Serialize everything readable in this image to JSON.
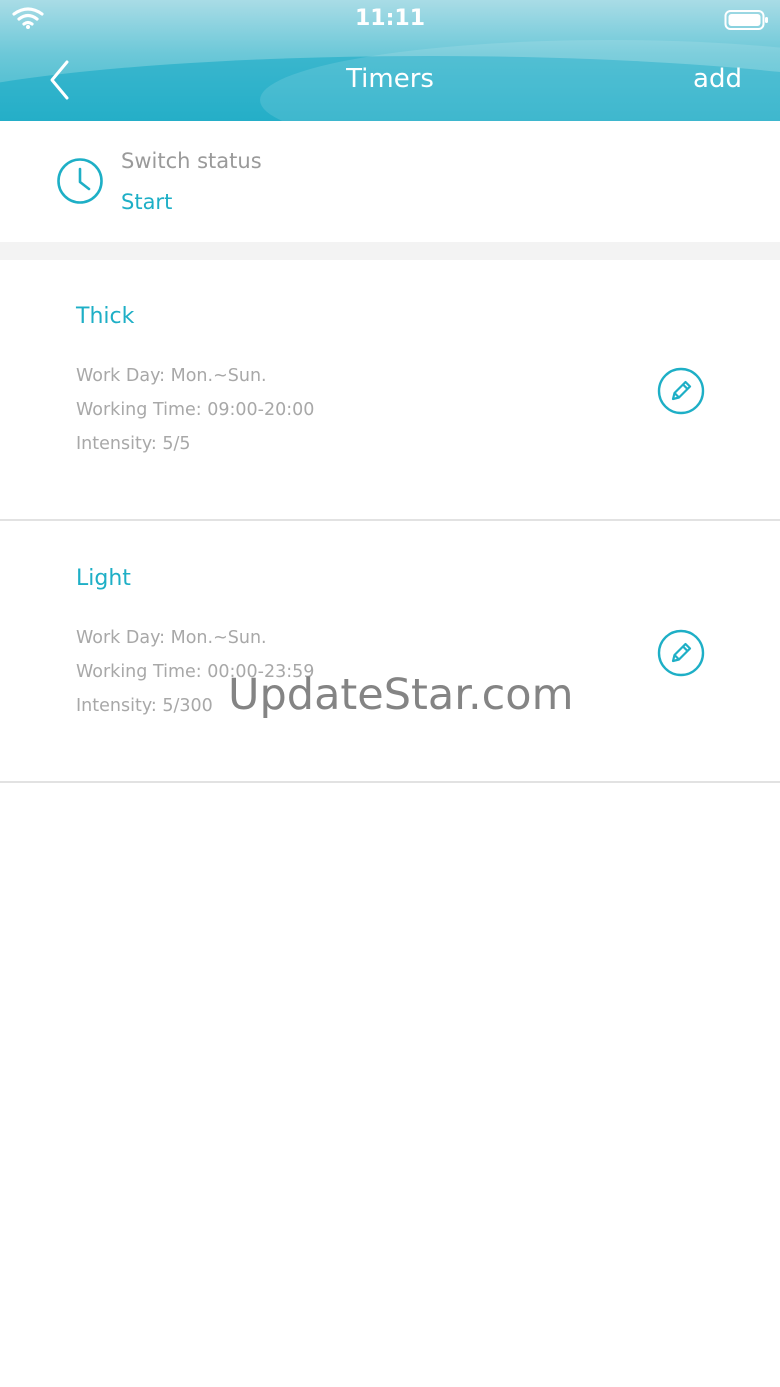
{
  "status_bar": {
    "time": "11:11"
  },
  "nav": {
    "title": "Timers",
    "add_label": "add"
  },
  "switch_status": {
    "label": "Switch status",
    "value": "Start"
  },
  "timers": [
    {
      "name": "Thick",
      "work_day": "Work Day: Mon.~Sun.",
      "working_time": "Working Time: 09:00-20:00",
      "intensity": "Intensity: 5/5"
    },
    {
      "name": "Light",
      "work_day": "Work Day: Mon.~Sun.",
      "working_time": "Working Time: 00:00-23:59",
      "intensity": "Intensity: 5/300"
    }
  ],
  "watermark": "UpdateStar.com",
  "colors": {
    "accent": "#1eafc6",
    "header": "#3bb7cc",
    "muted": "#a8a8a8"
  },
  "icons": [
    "wifi-icon",
    "battery-icon",
    "back-chevron-icon",
    "clock-icon",
    "pencil-icon"
  ]
}
